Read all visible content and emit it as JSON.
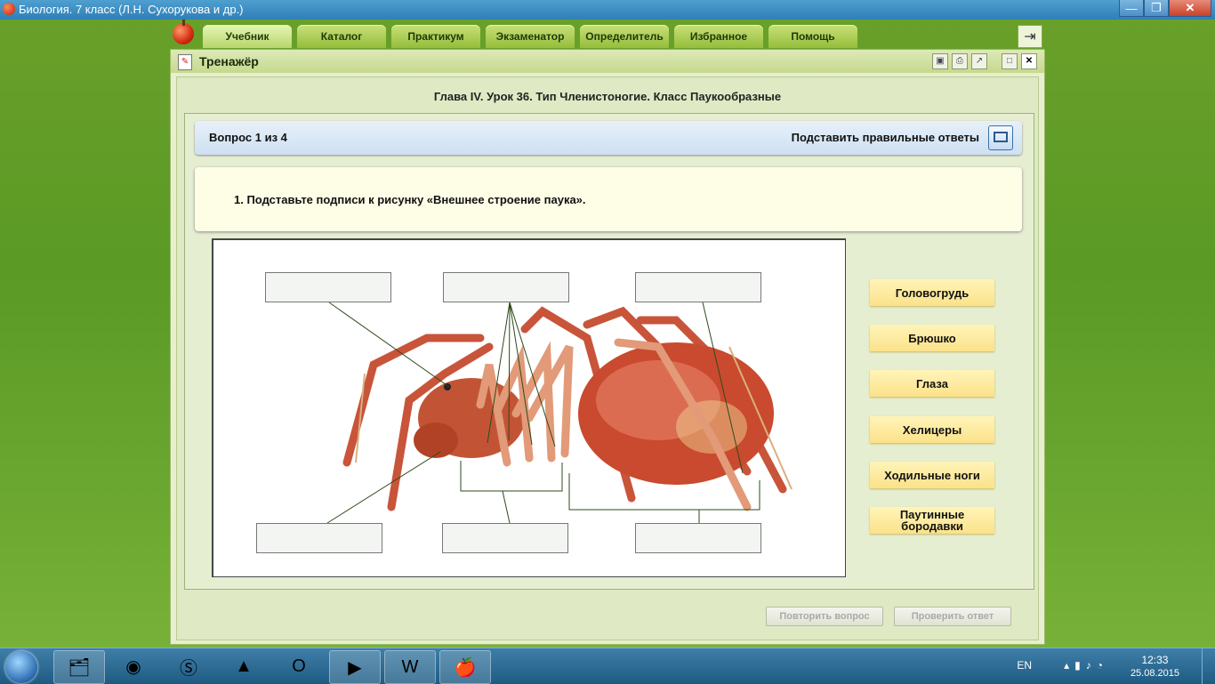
{
  "window": {
    "title": "Биология. 7 класс (Л.Н. Сухорукова и др.)",
    "minimize": "—",
    "maximize": "❐",
    "close": "✕"
  },
  "tabs": [
    {
      "label": "Учебник",
      "active": true
    },
    {
      "label": "Каталог"
    },
    {
      "label": "Практикум"
    },
    {
      "label": "Экзаменатор"
    },
    {
      "label": "Определитель"
    },
    {
      "label": "Избранное"
    },
    {
      "label": "Помощь"
    }
  ],
  "panel": {
    "title": "Тренажёр",
    "chapter": "Глава IV. Урок 36. Тип Членистоногие. Класс Паукообразные",
    "question_counter": "Вопрос 1 из 4",
    "substitute_answers": "Подставить правильные ответы",
    "task": "1. Подставьте подписи к рисунку «Внешнее строение паука».",
    "options": [
      "Головогрудь",
      "Брюшко",
      "Глаза",
      "Хелицеры",
      "Ходильные ноги",
      "Паутинные бородавки"
    ],
    "repeat_button": "Повторить вопрос",
    "check_button": "Проверить ответ"
  },
  "colors": {
    "accent_green": "#95bd3a",
    "option_yellow": "#fbe28a",
    "spider_red": "#c8412a"
  },
  "taskbar": {
    "apps": [
      "explorer-icon",
      "chrome-icon",
      "skype-icon",
      "aimp-icon",
      "opera-icon",
      "media-player-icon",
      "word-icon",
      "biology-app-icon"
    ],
    "language": "EN",
    "time": "12:33",
    "date": "25.08.2015"
  }
}
